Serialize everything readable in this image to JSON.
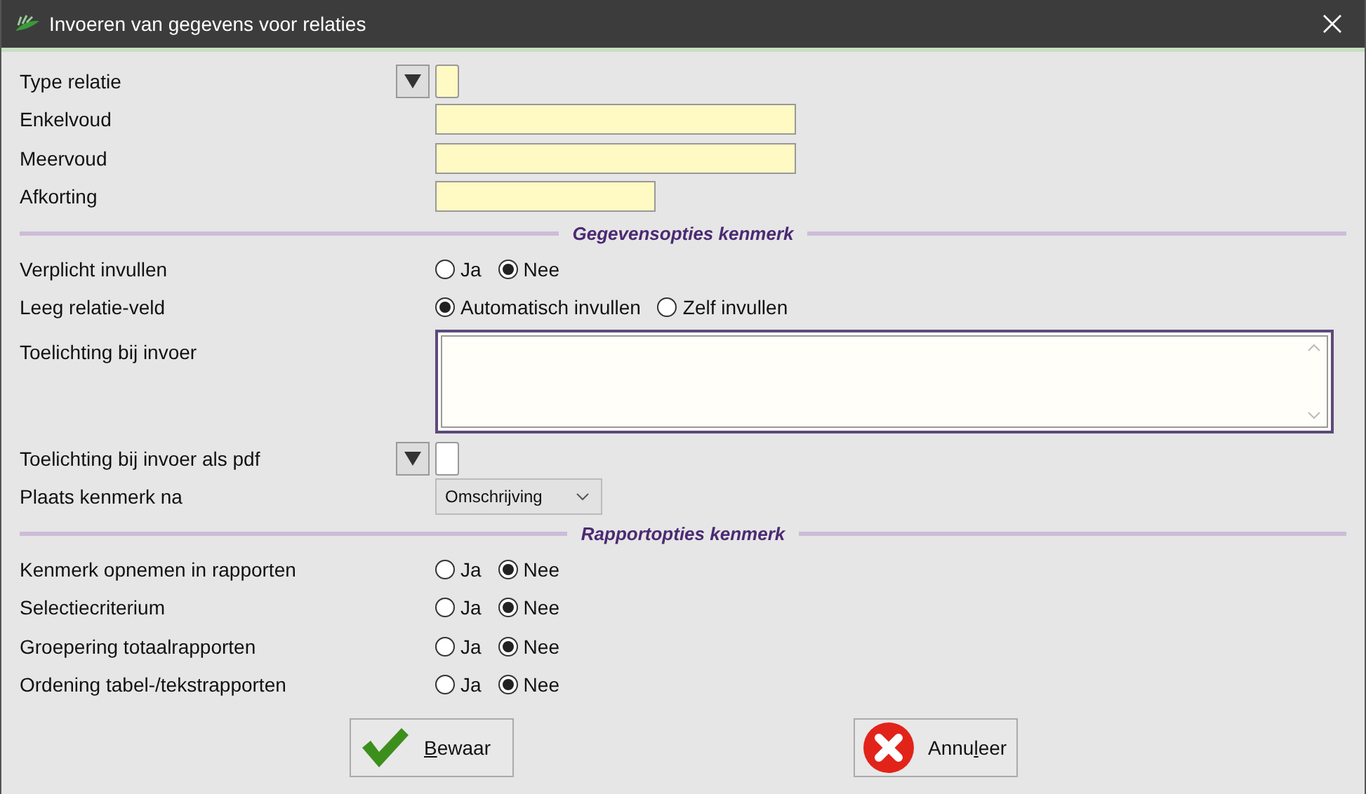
{
  "window": {
    "title": "Invoeren van gegevens voor relaties"
  },
  "fields": [
    {
      "kind": "lookup",
      "label": "Type relatie",
      "required": true
    },
    {
      "kind": "text",
      "label": "Enkelvoud",
      "required": true
    },
    {
      "kind": "text",
      "label": "Meervoud",
      "required": true
    },
    {
      "kind": "short",
      "label": "Afkorting",
      "required": true
    }
  ],
  "sections": [
    {
      "title": "Gegevensopties kenmerk",
      "rows": [
        {
          "kind": "radio",
          "label": "Verplicht invullen",
          "options": [
            {
              "label": "Ja",
              "selected": false
            },
            {
              "label": "Nee",
              "selected": true
            }
          ]
        },
        {
          "kind": "radio",
          "label": "Leeg relatie-veld",
          "options": [
            {
              "label": "Automatisch invullen",
              "selected": true
            },
            {
              "label": "Zelf invullen",
              "selected": false
            }
          ]
        },
        {
          "kind": "textarea",
          "label": "Toelichting bij invoer"
        },
        {
          "kind": "lookup",
          "label": "Toelichting bij invoer als pdf",
          "required": false
        },
        {
          "kind": "select",
          "label": "Plaats kenmerk na",
          "value": "Omschrijving"
        }
      ]
    },
    {
      "title": "Rapportopties kenmerk",
      "rows": [
        {
          "kind": "radio",
          "label": "Kenmerk opnemen in rapporten",
          "options": [
            {
              "label": "Ja",
              "selected": false
            },
            {
              "label": "Nee",
              "selected": true
            }
          ]
        },
        {
          "kind": "radio",
          "label": "Selectiecriterium",
          "options": [
            {
              "label": "Ja",
              "selected": false
            },
            {
              "label": "Nee",
              "selected": true
            }
          ]
        },
        {
          "kind": "radio",
          "label": "Groepering totaalrapporten",
          "options": [
            {
              "label": "Ja",
              "selected": false
            },
            {
              "label": "Nee",
              "selected": true
            }
          ]
        },
        {
          "kind": "radio",
          "label": "Ordening tabel-/tekstrapporten",
          "options": [
            {
              "label": "Ja",
              "selected": false
            },
            {
              "label": "Nee",
              "selected": true
            }
          ]
        }
      ]
    }
  ],
  "buttons": [
    {
      "kind": "save",
      "label_parts": [
        {
          "text": "B",
          "underlined": true
        },
        {
          "text": "ewaar",
          "underlined": false
        }
      ]
    },
    {
      "kind": "cancel",
      "label_parts": [
        {
          "text": "Annu",
          "underlined": false
        },
        {
          "text": "l",
          "underlined": true
        },
        {
          "text": "eer",
          "underlined": false
        }
      ]
    }
  ]
}
